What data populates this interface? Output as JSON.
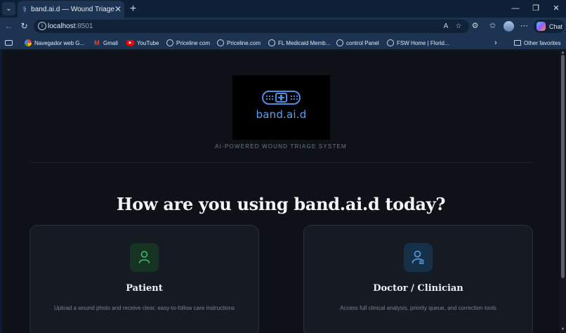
{
  "browser": {
    "tab_title": "band.ai.d — Wound Triage",
    "url_host": "localhost",
    "url_port": ":8501",
    "chat_label": "Chat",
    "bookmarks": [
      {
        "label": "Navegador web G...",
        "icon": "google-icon"
      },
      {
        "label": "Gmail",
        "icon": "gmail-icon"
      },
      {
        "label": "YouTube",
        "icon": "youtube-icon"
      },
      {
        "label": "Priceline com",
        "icon": "globe-icon"
      },
      {
        "label": "Priceline.com",
        "icon": "globe-icon"
      },
      {
        "label": "FL Medicaid Memb...",
        "icon": "globe-icon"
      },
      {
        "label": "control Panel",
        "icon": "globe-icon"
      },
      {
        "label": "FSW Home | Florid...",
        "icon": "globe-icon"
      }
    ],
    "other_favorites": "Other favorites"
  },
  "app": {
    "logo_text": "band.ai.d",
    "tagline": "AI-POWERED WOUND TRIAGE SYSTEM",
    "heading": "How are you using band.ai.d today?",
    "cards": [
      {
        "title": "Patient",
        "description": "Upload a wound photo and receive clear, easy-to-follow care instructions",
        "icon": "person-icon",
        "icon_color": "#3fbf6b",
        "icon_bg": "#173324"
      },
      {
        "title": "Doctor / Clinician",
        "description": "Access full clinical analysis, priority queue, and correction tools",
        "icon": "clinician-icon",
        "icon_color": "#5a9fe0",
        "icon_bg": "#17304a"
      }
    ]
  },
  "colors": {
    "accent": "#4a90e2",
    "page_bg": "#0e1118",
    "card_bg": "#161a23"
  }
}
